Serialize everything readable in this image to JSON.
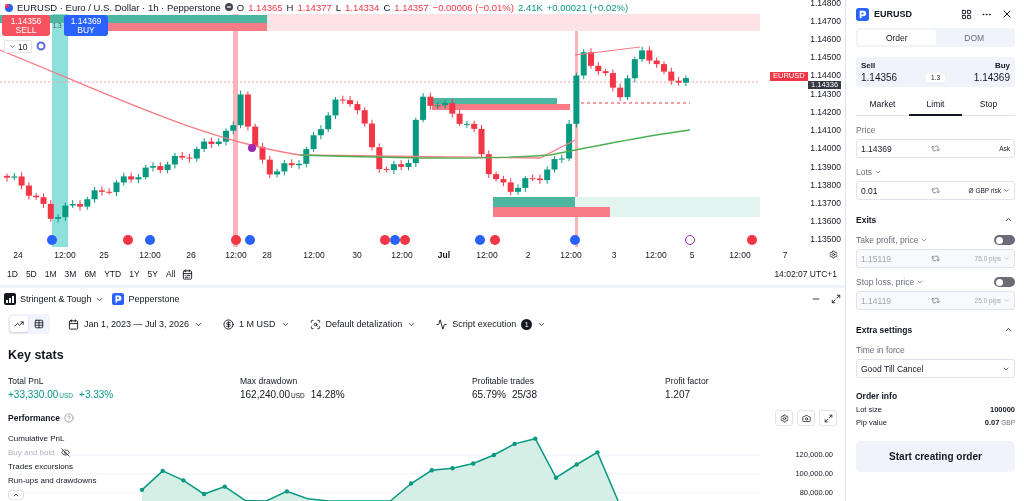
{
  "chart": {
    "symbol_line": "EURUSD · Euro / U.S. Dollar · 1h · Pepperstone",
    "ohlc": [
      {
        "key": "O",
        "value": "1.14365"
      },
      {
        "key": "H",
        "value": "1.14377"
      },
      {
        "key": "L",
        "value": "1.14334"
      },
      {
        "key": "C",
        "value": "1.14357"
      }
    ],
    "change": "−0.00006 (−0.01%)",
    "volume": "2.41K",
    "volume_change": "+0.00021 (+0.02%)",
    "sell": {
      "price": "1.14356",
      "label": "SELL"
    },
    "spread": "1.3",
    "buy": {
      "price": "1.14369",
      "label": "BUY"
    },
    "indicator_count": "10",
    "price_axis": [
      "1.14800",
      "1.14700",
      "1.14600",
      "1.14500",
      "1.14400",
      "1.14300",
      "1.14200",
      "1.14100",
      "1.14000",
      "1.13900",
      "1.13800",
      "1.13700",
      "1.13600",
      "1.13500"
    ],
    "symbol_tag": "EURUSD",
    "last_price": "1.14336",
    "time_axis": [
      "24",
      "12:00",
      "25",
      "12:00",
      "26",
      "12:00",
      "28",
      "12:00",
      "30",
      "12:00",
      "Jul",
      "12:00",
      "2",
      "12:00",
      "3",
      "12:00",
      "5",
      "12:00",
      "7"
    ]
  },
  "ranges": [
    "1D",
    "5D",
    "1M",
    "3M",
    "6M",
    "YTD",
    "1Y",
    "5Y",
    "All"
  ],
  "clock": "14:02:07 UTC+1",
  "strategy_tabs": [
    {
      "kind": "strategy",
      "label": "Stringent & Tough"
    },
    {
      "kind": "broker",
      "label": "Pepperstone"
    }
  ],
  "toolbar": {
    "views": [
      {
        "kind": "chart",
        "selected": true
      },
      {
        "kind": "table",
        "selected": false
      }
    ],
    "filters": [
      {
        "kind": "date",
        "label": "Jan 1, 2023 — Jul 3, 2026"
      },
      {
        "kind": "capital",
        "label": "1 M USD"
      },
      {
        "kind": "detail",
        "label": "Default detalization"
      },
      {
        "kind": "script",
        "label": "Script execution",
        "badge": "1"
      }
    ]
  },
  "key_stats": {
    "title": "Key stats",
    "items": [
      {
        "label": "Total PnL",
        "value": "+33,330.00",
        "unit": "USD",
        "secondary": "+3.33%",
        "positive": true
      },
      {
        "label": "Max drawdown",
        "value": "162,240.00",
        "unit": "USD",
        "secondary": "14.28%",
        "positive": false
      },
      {
        "label": "Profitable trades",
        "value": "65.79%",
        "secondary": "25/38",
        "positive": false
      },
      {
        "label": "Profit factor",
        "value": "1.207",
        "positive": false
      }
    ]
  },
  "performance": {
    "title": "Performance",
    "legend": [
      {
        "label": "Buy and hold",
        "disabled": true
      },
      {
        "label": "Trades excursions",
        "disabled": false
      },
      {
        "label": "Run-ups and drawdowns",
        "disabled": false
      }
    ],
    "series_name": "Cumulative PnL",
    "axis_labels": [
      "120,000.00",
      "100,000.00",
      "80,000.00"
    ]
  },
  "order_panel": {
    "symbol": "EURUSD",
    "modes": [
      {
        "label": "Order",
        "selected": true
      },
      {
        "label": "DOM",
        "selected": false
      }
    ],
    "sell": {
      "label": "Sell",
      "price": "1.14356"
    },
    "spread": "1.3",
    "buy": {
      "label": "Buy",
      "price": "1.14369"
    },
    "types": [
      {
        "label": "Market",
        "selected": false
      },
      {
        "label": "Limit",
        "selected": true
      },
      {
        "label": "Stop",
        "selected": false
      }
    ],
    "price": {
      "label": "Price",
      "value": "1.14369",
      "suffix": "Ask"
    },
    "lots": {
      "label": "Lots",
      "value": "0.01",
      "suffix": "Ø GBP risk"
    },
    "exits": {
      "title": "Exits",
      "expanded": true,
      "items": [
        {
          "label": "Take profit, price",
          "on": false,
          "value": "1.15119",
          "suffix": "75.0 pips"
        },
        {
          "label": "Stop loss, price",
          "on": false,
          "value": "1.14119",
          "suffix": "25.0 pips"
        }
      ]
    },
    "extra": {
      "title": "Extra settings",
      "expanded": true,
      "field_label": "Time in force",
      "value": "Good Till Cancel"
    },
    "order_info": {
      "title": "Order info",
      "rows": [
        {
          "label": "Lot size",
          "value": "100000"
        },
        {
          "label": "Pip value",
          "value": "0.07",
          "unit": "GBP"
        }
      ]
    },
    "submit": "Start creating order"
  }
}
